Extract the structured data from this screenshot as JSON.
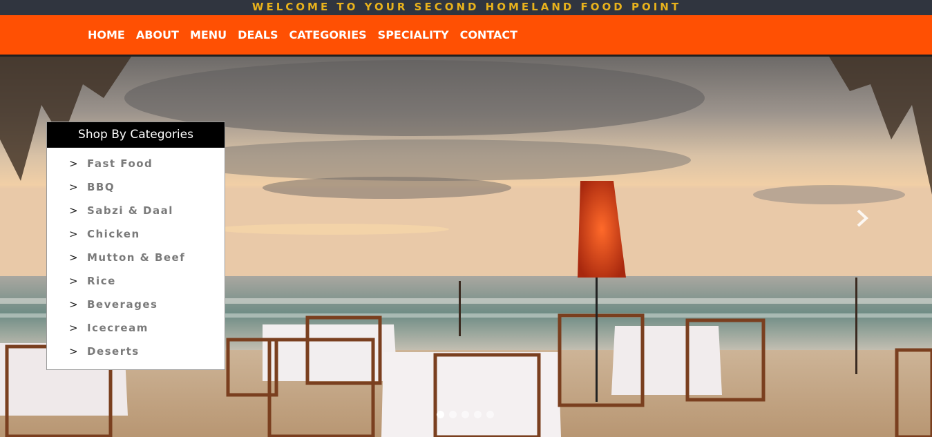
{
  "banner": {
    "text": "WELCOME TO YOUR SECOND HOMELAND FOOD POINT"
  },
  "nav": {
    "items": [
      "HOME",
      "ABOUT",
      "MENU",
      "DEALS",
      "CATEGORIES",
      "SPECIALITY",
      "CONTACT"
    ]
  },
  "categories": {
    "title": "Shop By Categories",
    "arrow": ">",
    "items": [
      "Fast Food",
      "BBQ",
      "Sabzi & Daal",
      "Chicken",
      "Mutton & Beef",
      "Rice",
      "Beverages",
      "Icecream",
      "Deserts"
    ]
  },
  "carousel": {
    "slide_count": 5,
    "active_index": 0,
    "next_icon": "chevron-right-icon"
  },
  "colors": {
    "banner_bg": "#30353f",
    "banner_text": "#e8b21c",
    "nav_bg": "#ff5003"
  }
}
